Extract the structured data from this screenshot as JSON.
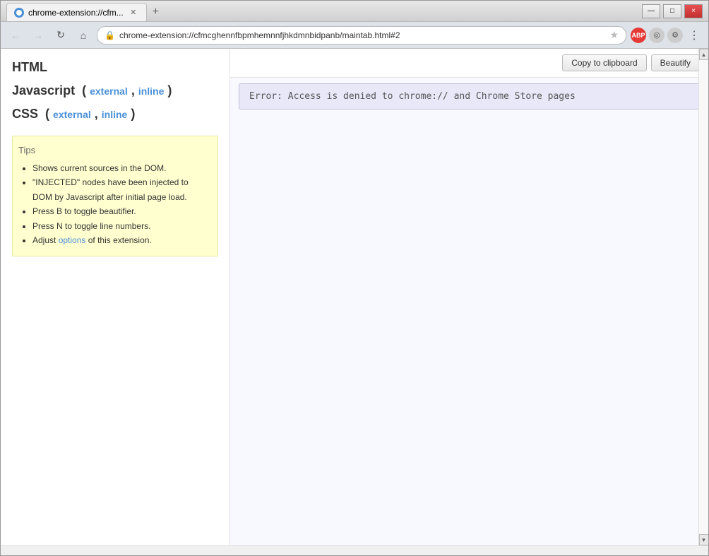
{
  "window": {
    "title": "chrome-extension://cfm...",
    "tab_label": "chrome-extension://cfm...",
    "close_label": "×",
    "minimize_label": "—",
    "maximize_label": "□"
  },
  "nav": {
    "back_title": "Back",
    "forward_title": "Forward",
    "reload_title": "Reload",
    "home_title": "Home",
    "address": "chrome-extension://cfmcghennfbpmhemnnfjhkdmnbidpanb/maintab.html#2",
    "address_placeholder": "",
    "menu_title": "Menu"
  },
  "toolbar": {
    "copy_label": "Copy to clipboard",
    "beautify_label": "Beautify"
  },
  "error": {
    "message": "Error: Access is denied to chrome:// and Chrome Store pages"
  },
  "left": {
    "html_title": "HTML",
    "javascript_title": "Javascript",
    "javascript_links": [
      "external",
      "inline"
    ],
    "css_title": "CSS",
    "css_links": [
      "external",
      "inline"
    ]
  },
  "tips": {
    "title": "Tips",
    "items": [
      "Shows current sources in the DOM.",
      "\"INJECTED\" nodes have been injected to DOM by Javascript after initial page load.",
      "Press B to toggle beautifier.",
      "Press N to toggle line numbers.",
      "Adjust options of this extension."
    ],
    "options_link_text": "options",
    "options_link_index": 4
  },
  "abp": {
    "label": "ABP"
  }
}
